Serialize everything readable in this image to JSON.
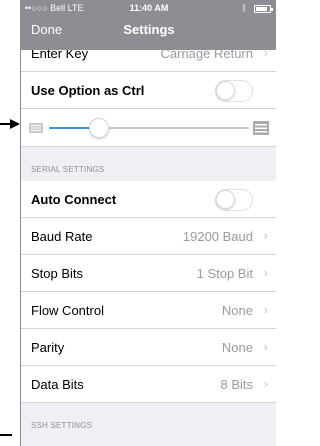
{
  "status": {
    "carrier": "••○○○ Bell LTE",
    "time": "11:40 AM",
    "bluetooth": "ᛒ"
  },
  "nav": {
    "done": "Done",
    "title": "Settings"
  },
  "rows_top": {
    "enter_key": {
      "label": "Enter Key",
      "value": "Carriage Return"
    },
    "use_option": {
      "label": "Use Option as Ctrl",
      "toggle": "off"
    }
  },
  "slider": {
    "value": 0.25
  },
  "serial": {
    "header": "SERIAL SETTINGS",
    "auto_connect": {
      "label": "Auto Connect",
      "toggle": "off"
    },
    "baud_rate": {
      "label": "Baud Rate",
      "value": "19200 Baud"
    },
    "stop_bits": {
      "label": "Stop Bits",
      "value": "1 Stop Bit"
    },
    "flow_control": {
      "label": "Flow Control",
      "value": "None"
    },
    "parity": {
      "label": "Parity",
      "value": "None"
    },
    "data_bits": {
      "label": "Data Bits",
      "value": "8 Bits"
    }
  },
  "ssh": {
    "header": "SSH SETTINGS"
  },
  "icons": {
    "chevron": "›",
    "accent": "#3a8ee6",
    "navbar_bg": "#8d8d93"
  }
}
